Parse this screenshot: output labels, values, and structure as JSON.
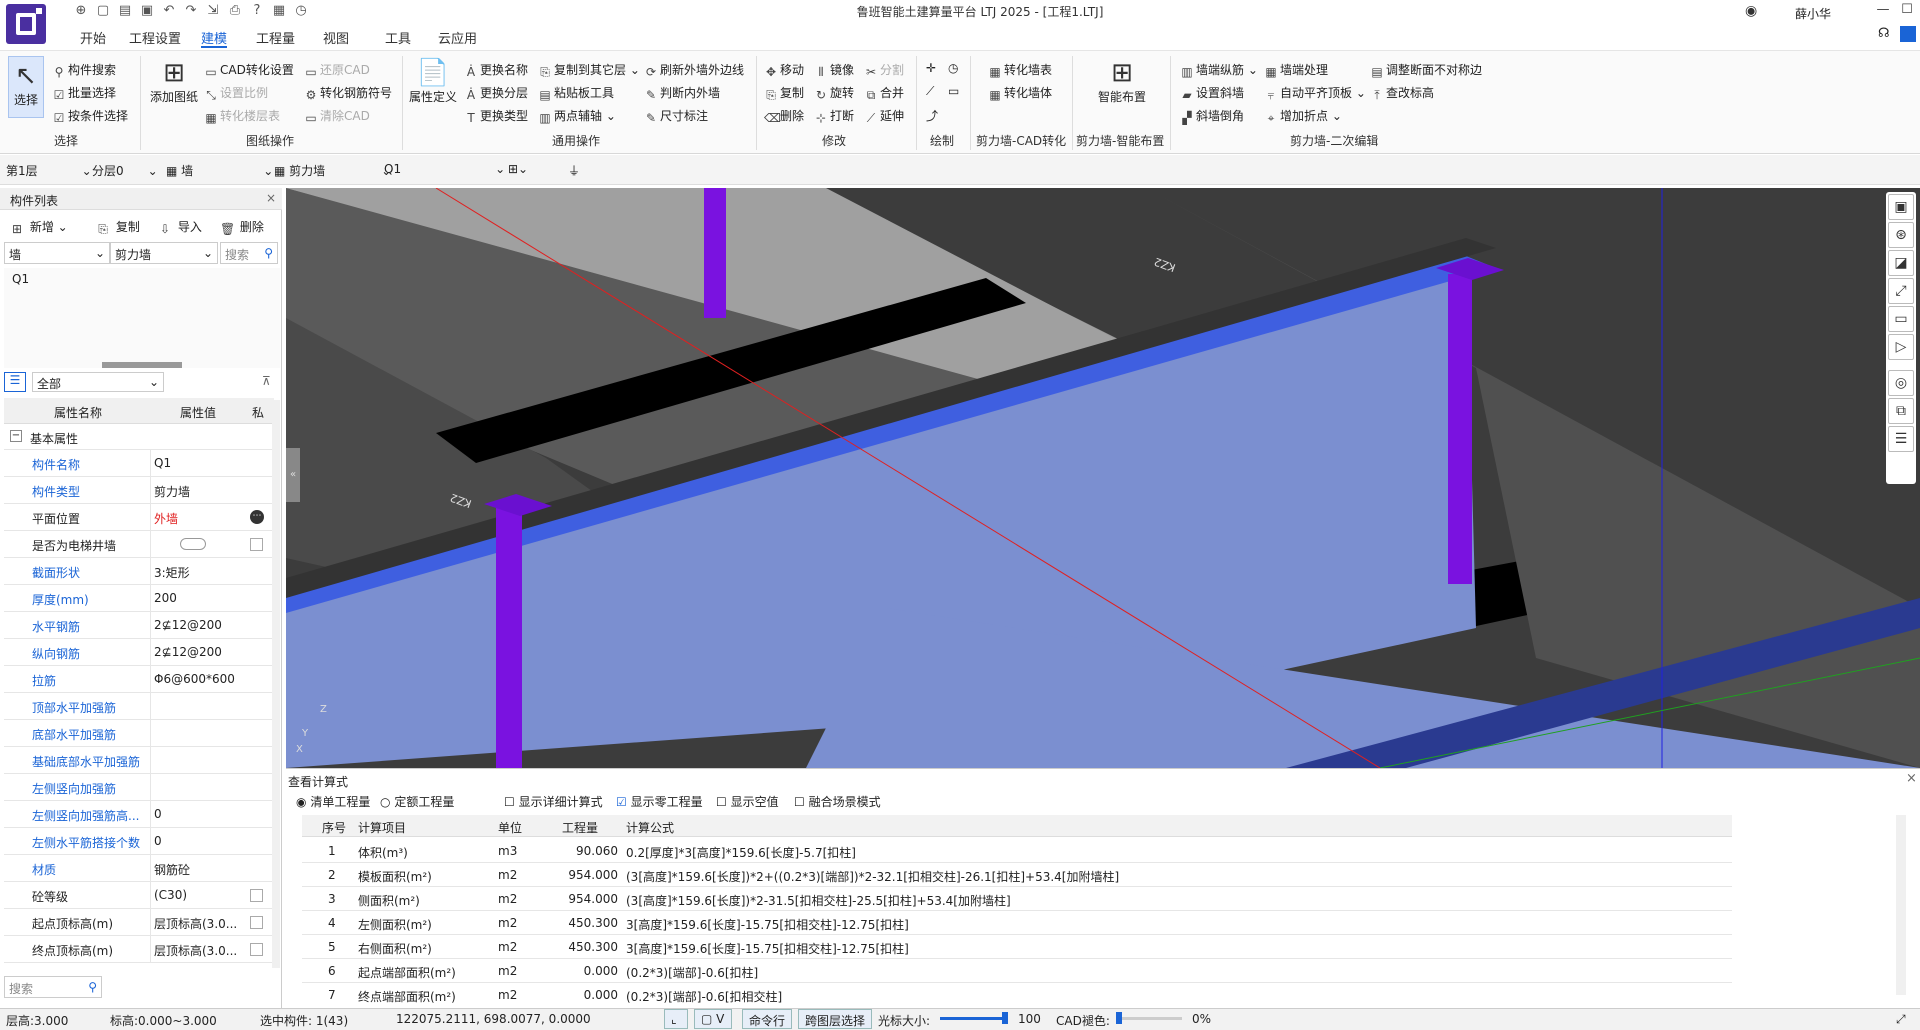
{
  "app_title": "鲁班智能土建算量平台 LTJ 2025 - [工程1.LTJ]",
  "user": {
    "name": "薛小华"
  },
  "menu": [
    "开始",
    "工程设置",
    "建模",
    "工程量",
    "视图",
    "工具",
    "云应用"
  ],
  "ribbon": {
    "select": {
      "label": "选择",
      "items": [
        "构件搜索",
        "批量选择",
        "按条件选择"
      ],
      "group": "选择"
    },
    "drawing": {
      "add_label": "添加图纸",
      "items": [
        "CAD转化设置",
        "设置比例",
        "转化楼层表",
        "还原CAD",
        "转化钢筋符号",
        "清除CAD"
      ],
      "group": "图纸操作"
    },
    "common": {
      "prop_label": "属性定义",
      "items": [
        "更换名称",
        "更换分层",
        "更换类型",
        "复制到其它层",
        "粘贴板工具",
        "两点辅轴",
        "刷新外墙外边线",
        "判断内外墙",
        "尺寸标注"
      ],
      "group": "通用操作"
    },
    "modify": {
      "items": [
        "移动",
        "镜像",
        "分割",
        "复制",
        "旋转",
        "合并",
        "删除",
        "打断",
        "延伸"
      ],
      "group": "修改"
    },
    "draw": {
      "group": "绘制"
    },
    "cad": {
      "items": [
        "转化墙表",
        "转化墙体"
      ],
      "group": "剪力墙-CAD转化"
    },
    "smart": {
      "label": "智能布置",
      "group": "剪力墙-智能布置"
    },
    "edit2": {
      "items": [
        "墙端纵筋",
        "设置斜墙",
        "斜墙倒角",
        "墙端处理",
        "自动平齐顶板",
        "增加折点",
        "调整断面不对称边",
        "查改标高"
      ],
      "group": "剪力墙-二次编辑"
    }
  },
  "toolbar2": {
    "floor": "第1层",
    "layer": "分层0",
    "category": "墙",
    "type": "剪力墙",
    "name": "Q1"
  },
  "comp_list": {
    "title": "构件列表",
    "actions": [
      "新增",
      "复制",
      "导入",
      "删除"
    ],
    "filter_category": "墙",
    "filter_type": "剪力墙",
    "search_placeholder": "搜索",
    "items": [
      "Q1"
    ]
  },
  "props": {
    "filter": "全部",
    "headers": [
      "属性名称",
      "属性值",
      "私"
    ],
    "section": "基本属性",
    "rows": [
      {
        "name": "构件名称",
        "value": "Q1",
        "blue": true,
        "check": false
      },
      {
        "name": "构件类型",
        "value": "剪力墙",
        "blue": true,
        "check": false
      },
      {
        "name": "平面位置",
        "value": "外墙",
        "blue": false,
        "red": true,
        "check": false,
        "dot": true
      },
      {
        "name": "是否为电梯井墙",
        "value": "",
        "blue": false,
        "check": true,
        "toggle": true
      },
      {
        "name": "截面形状",
        "value": "3:矩形",
        "blue": true,
        "check": false
      },
      {
        "name": "厚度(mm)",
        "value": "200",
        "blue": true,
        "check": false
      },
      {
        "name": "水平钢筋",
        "value": "2⊈12@200",
        "blue": true,
        "check": false
      },
      {
        "name": "纵向钢筋",
        "value": "2⊈12@200",
        "blue": true,
        "check": false
      },
      {
        "name": "拉筋",
        "value": "Φ6@600*600",
        "blue": true,
        "check": false
      },
      {
        "name": "顶部水平加强筋",
        "value": "",
        "blue": true,
        "check": false
      },
      {
        "name": "底部水平加强筋",
        "value": "",
        "blue": true,
        "check": false
      },
      {
        "name": "基础底部水平加强筋",
        "value": "",
        "blue": true,
        "check": false
      },
      {
        "name": "左侧竖向加强筋",
        "value": "",
        "blue": true,
        "check": false
      },
      {
        "name": "左侧竖向加强筋高...",
        "value": "0",
        "blue": true,
        "check": false
      },
      {
        "name": "左侧水平筋搭接个数",
        "value": "0",
        "blue": true,
        "check": false
      },
      {
        "name": "材质",
        "value": "钢筋砼",
        "blue": true,
        "check": false
      },
      {
        "name": "砼等级",
        "value": "(C30)",
        "blue": false,
        "check": true
      },
      {
        "name": "起点顶标高(m)",
        "value": "层顶标高(3.0...",
        "blue": false,
        "check": true
      },
      {
        "name": "终点顶标高(m)",
        "value": "层顶标高(3.0...",
        "blue": false,
        "check": true
      }
    ],
    "search_placeholder": "搜索"
  },
  "viewport": {
    "labels": [
      "KZ2",
      "KZ2"
    ],
    "axis": [
      "Z",
      "Y",
      "X"
    ]
  },
  "calc": {
    "title": "查看计算式",
    "modes": [
      "清单工程量",
      "定额工程量"
    ],
    "options": [
      {
        "label": "显示详细计算式",
        "checked": false
      },
      {
        "label": "显示零工程量",
        "checked": true
      },
      {
        "label": "显示空值",
        "checked": false
      },
      {
        "label": "融合场景模式",
        "checked": false
      }
    ],
    "headers": [
      "序号",
      "计算项目",
      "单位",
      "工程量",
      "计算公式"
    ],
    "rows": [
      {
        "no": "1",
        "item": "体积(m³)",
        "unit": "m3",
        "qty": "90.060",
        "formula": "0.2[厚度]*3[高度]*159.6[长度]-5.7[扣柱]"
      },
      {
        "no": "2",
        "item": "模板面积(m²)",
        "unit": "m2",
        "qty": "954.000",
        "formula": "(3[高度]*159.6[长度])*2+((0.2*3)[端部])*2-32.1[扣相交柱]-26.1[扣柱]+53.4[加附墙柱]"
      },
      {
        "no": "3",
        "item": "侧面积(m²)",
        "unit": "m2",
        "qty": "954.000",
        "formula": "(3[高度]*159.6[长度])*2-31.5[扣相交柱]-25.5[扣柱]+53.4[加附墙柱]"
      },
      {
        "no": "4",
        "item": "左侧面积(m²)",
        "unit": "m2",
        "qty": "450.300",
        "formula": "3[高度]*159.6[长度]-15.75[扣相交柱]-12.75[扣柱]"
      },
      {
        "no": "5",
        "item": "右侧面积(m²)",
        "unit": "m2",
        "qty": "450.300",
        "formula": "3[高度]*159.6[长度]-15.75[扣相交柱]-12.75[扣柱]"
      },
      {
        "no": "6",
        "item": "起点端部面积(m²)",
        "unit": "m2",
        "qty": "0.000",
        "formula": "(0.2*3)[端部]-0.6[扣柱]"
      },
      {
        "no": "7",
        "item": "终点端部面积(m²)",
        "unit": "m2",
        "qty": "0.000",
        "formula": "(0.2*3)[端部]-0.6[扣相交柱]"
      }
    ]
  },
  "status": {
    "floor_height": "层高:3.000",
    "elevation": "标高:0.000~3.000",
    "selected": "选中构件: 1(43)",
    "coords": "122075.2111, 698.0077, 0.0000",
    "btn_v": "V",
    "btn_cmd": "命令行",
    "btn_cross": "跨图层选择",
    "cursor_label": "光标大小:",
    "cursor_value": "100",
    "cad_label": "CAD褪色:",
    "cad_value": "0%"
  },
  "colors": {
    "accent": "#1a64d6",
    "wall": "#7b8fd0",
    "column": "#7a12e0",
    "bg3d": "#3c3c3c"
  }
}
